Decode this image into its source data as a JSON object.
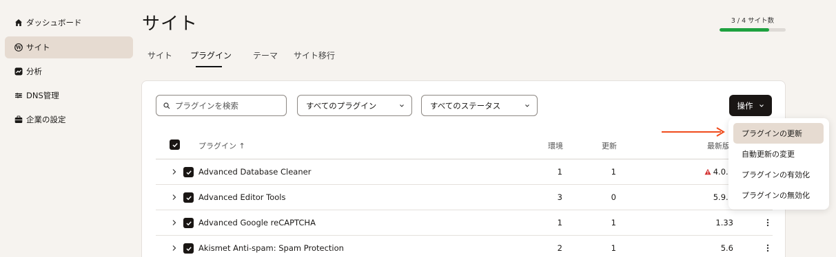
{
  "sidebar": {
    "items": [
      {
        "label": "ダッシュボード",
        "icon": "home-icon",
        "active": false
      },
      {
        "label": "サイト",
        "icon": "wordpress-icon",
        "active": true
      },
      {
        "label": "分析",
        "icon": "chart-icon",
        "active": false
      },
      {
        "label": "DNS管理",
        "icon": "dns-icon",
        "active": false
      },
      {
        "label": "企業の設定",
        "icon": "briefcase-icon",
        "active": false
      }
    ]
  },
  "header": {
    "title": "サイト",
    "quota_text": "3 / 4 サイト数",
    "quota_fraction": 0.75
  },
  "tabs": [
    {
      "label": "サイト",
      "active": false
    },
    {
      "label": "プラグイン",
      "active": true
    },
    {
      "label": "テーマ",
      "active": false
    },
    {
      "label": "サイト移行",
      "active": false
    }
  ],
  "toolbar": {
    "search_placeholder": "プラグインを検索",
    "filter_plugins": "すべてのプラグイン",
    "filter_status": "すべてのステータス",
    "action_label": "操作"
  },
  "table": {
    "columns": {
      "plugin": "プラグイン ↑",
      "env": "環境",
      "update": "更新",
      "latest": "最新版"
    },
    "rows": [
      {
        "name": "Advanced Database Cleaner",
        "env": "1",
        "update": "1",
        "latest": "4.0.7",
        "warning": true
      },
      {
        "name": "Advanced Editor Tools",
        "env": "3",
        "update": "0",
        "latest": "5.9.2",
        "warning": false
      },
      {
        "name": "Advanced Google reCAPTCHA",
        "env": "1",
        "update": "1",
        "latest": "1.33",
        "warning": false
      },
      {
        "name": "Akismet Anti-spam: Spam Protection",
        "env": "2",
        "update": "1",
        "latest": "5.6",
        "warning": false
      }
    ]
  },
  "menu": {
    "items": [
      "プラグインの更新",
      "自動更新の変更",
      "プラグインの有効化",
      "プラグインの無効化"
    ],
    "highlighted_index": 0
  },
  "colors": {
    "accent_dark": "#1a1614",
    "highlight": "#e6dbd1",
    "progress": "#1ea13f",
    "warning": "#d32f2f",
    "arrow": "#f04a1a"
  }
}
